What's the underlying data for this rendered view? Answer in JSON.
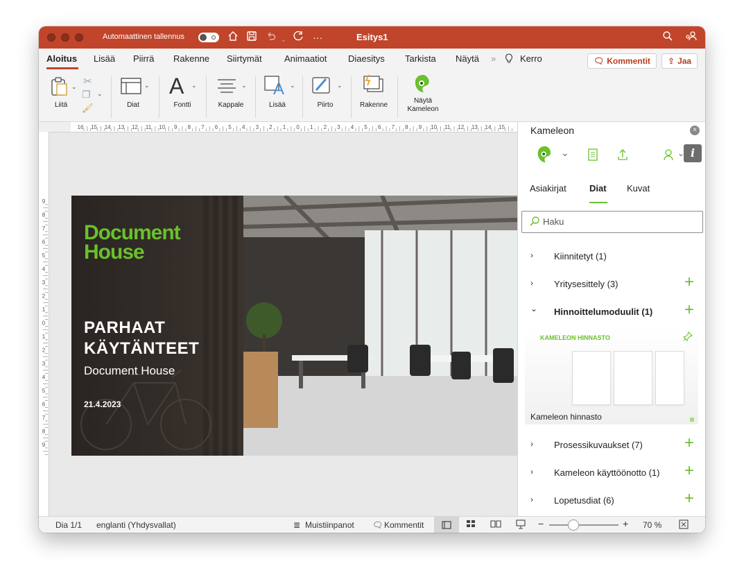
{
  "titlebar": {
    "autosave_label": "Automaattinen tallennus",
    "title": "Esitys1",
    "icons": [
      "home-icon",
      "save-icon",
      "undo-icon",
      "redo-icon",
      "more-icon",
      "search-icon",
      "share-people-icon"
    ]
  },
  "ribbon": {
    "tabs": [
      "Aloitus",
      "Lisää",
      "Piirrä",
      "Rakenne",
      "Siirtymät",
      "Animaatiot",
      "Diaesitys",
      "Tarkista",
      "Näytä"
    ],
    "active_tab": "Aloitus",
    "overflow": "»",
    "tell_me": "Kerro",
    "comments_button": "Kommentit",
    "share_button": "Jaa",
    "groups": {
      "paste": "Liitä",
      "slides": "Diat",
      "font": "Fontti",
      "paragraph": "Kappale",
      "insert": "Lisää",
      "drawing": "Piirto",
      "design": "Rakenne",
      "kameleon_line1": "Näytä",
      "kameleon_line2": "Kameleon"
    }
  },
  "ruler": {
    "h_ticks": [
      "16",
      "15",
      "14",
      "13",
      "12",
      "11",
      "10",
      "9",
      "8",
      "7",
      "6",
      "5",
      "4",
      "3",
      "2",
      "1",
      "0",
      "1",
      "2",
      "3",
      "4",
      "5",
      "6",
      "7",
      "8",
      "9",
      "10",
      "11",
      "12",
      "13",
      "14",
      "15"
    ],
    "v_ticks": [
      "9",
      "8",
      "7",
      "6",
      "5",
      "4",
      "3",
      "2",
      "1",
      "0",
      "1",
      "2",
      "3",
      "4",
      "5",
      "6",
      "7",
      "8",
      "9"
    ]
  },
  "slide": {
    "logo_line1": "Document",
    "logo_line2": "House",
    "title_line1": "PARHAAT",
    "title_line2": "KÄYTÄNTEET",
    "subtitle": "Document House",
    "date": "21.4.2023"
  },
  "panel": {
    "title": "Kameleon",
    "close": "×",
    "info": "i",
    "tabs": [
      "Asiakirjat",
      "Diat",
      "Kuvat"
    ],
    "active_tab": "Diat",
    "search_placeholder": "Haku",
    "items": [
      {
        "label": "Kiinnitetyt (1)",
        "chevron": "›",
        "plus": ""
      },
      {
        "label": "Yritysesittely (3)",
        "chevron": "›",
        "plus": "+"
      },
      {
        "label": "Hinnoittelumoduulit (1)",
        "chevron": "⌄",
        "plus": "+"
      },
      {
        "label": "Prosessikuvaukset (7)",
        "chevron": "›",
        "plus": "+"
      },
      {
        "label": "Kameleon käyttöönotto (1)",
        "chevron": "›",
        "plus": "+"
      },
      {
        "label": "Lopetusdiat (6)",
        "chevron": "›",
        "plus": "+"
      }
    ],
    "thumbnail": {
      "slide_title": "KAMELEON HINNASTO",
      "label": "Kameleon hinnasto"
    }
  },
  "status": {
    "slide": "Dia 1/1",
    "language": "englanti (Yhdysvallat)",
    "notes": "Muistiinpanot",
    "comments": "Kommentit",
    "zoom": "70 %"
  },
  "colors": {
    "accent": "#c0452b",
    "brand_green": "#6ac12a"
  }
}
